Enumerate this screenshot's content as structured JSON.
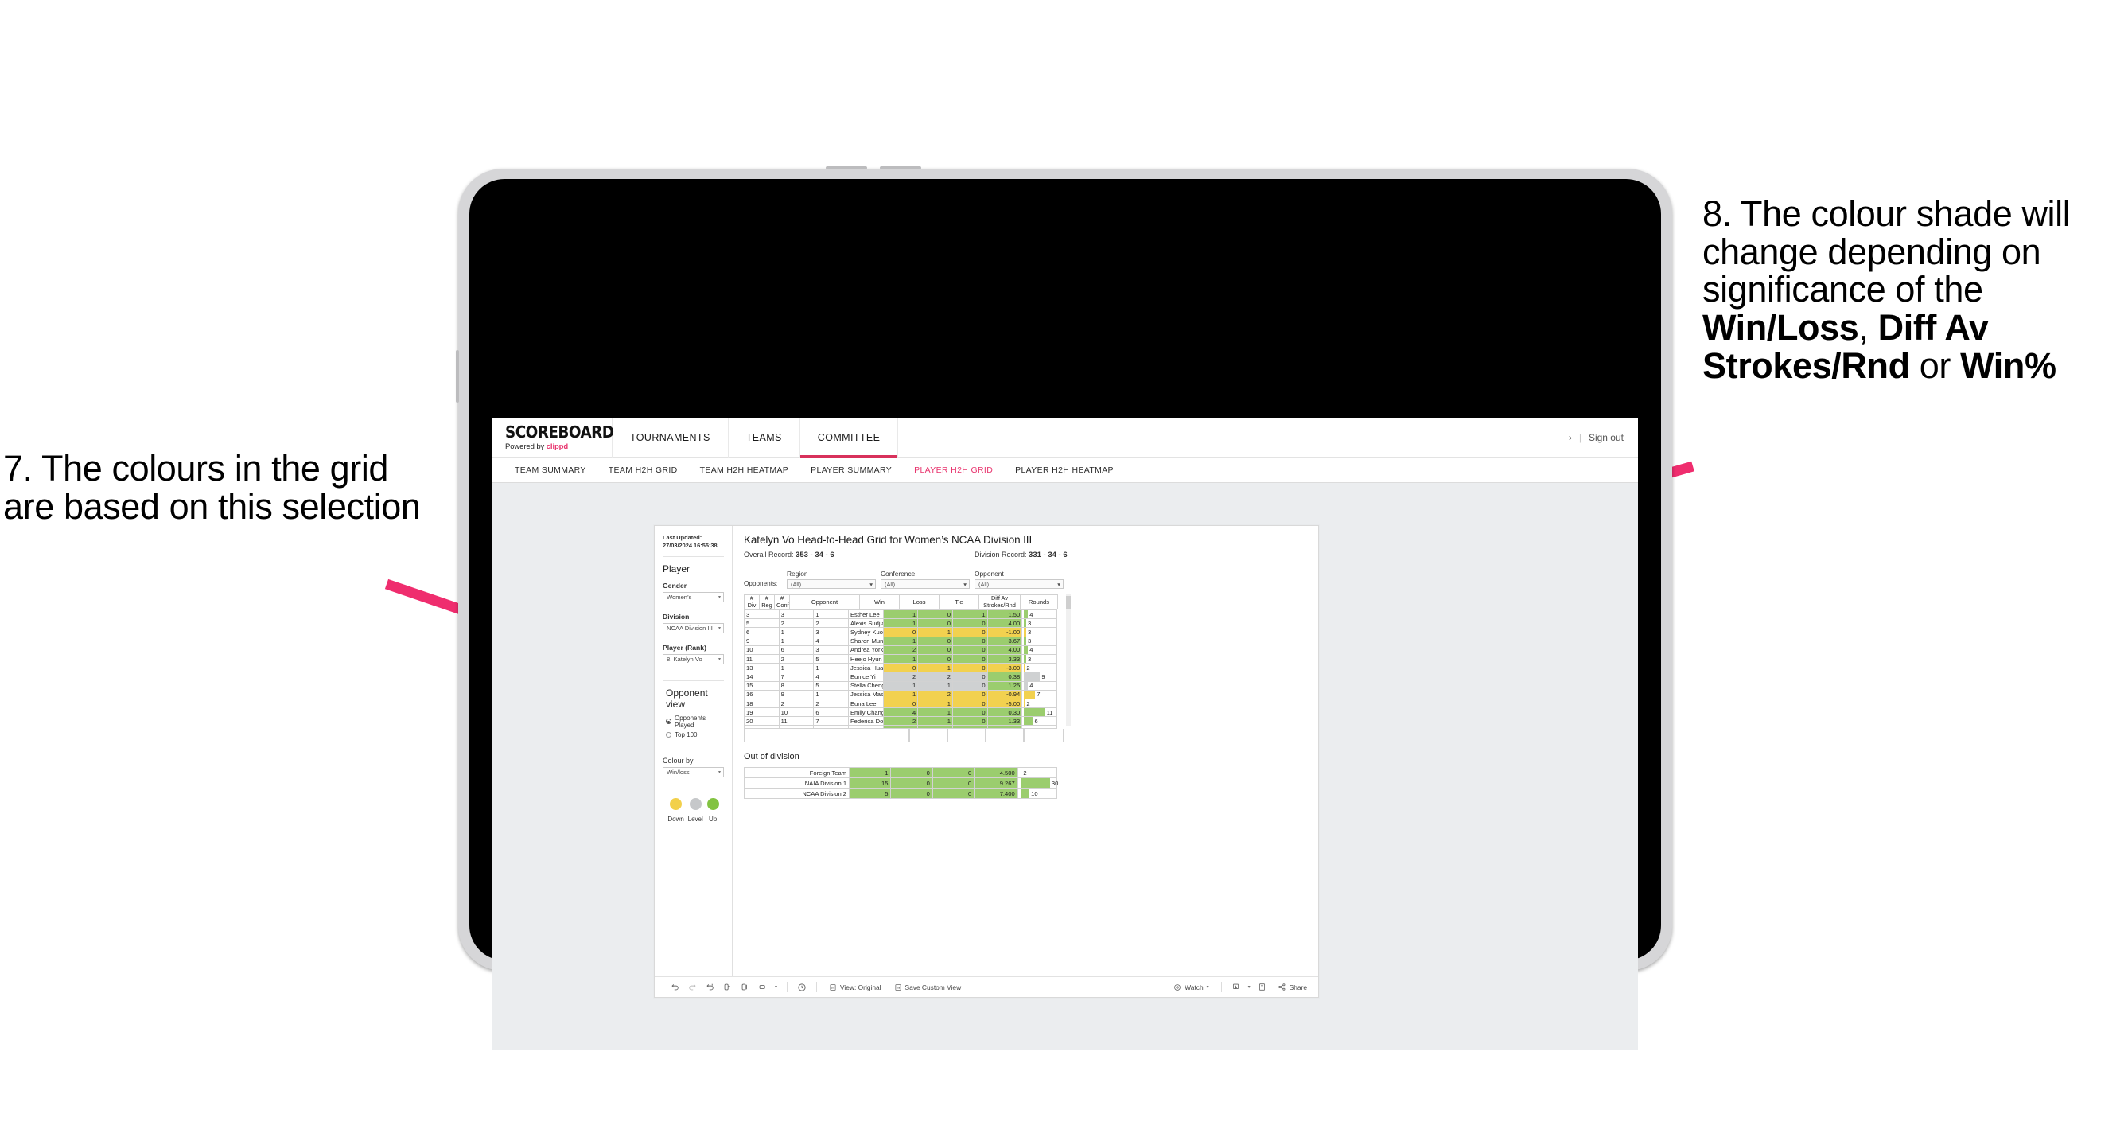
{
  "annotations": {
    "left": {
      "id": "annotation-7",
      "text": "7. The colours in the grid are based on this selection"
    },
    "right": {
      "id": "annotation-8",
      "line1": "8. The colour shade will change depending on significance of the ",
      "bold1": "Win/Loss",
      "mid1": ", ",
      "bold2": "Diff Av Strokes/Rnd",
      "mid2": " or ",
      "bold3": "Win%"
    },
    "arrow_color": "#ef2d6e"
  },
  "header": {
    "logo_main": "SCOREBOARD",
    "logo_sub_prefix": "Powered by ",
    "logo_sub_brand": "clippd",
    "nav": [
      {
        "label": "TOURNAMENTS",
        "active": false
      },
      {
        "label": "TEAMS",
        "active": false
      },
      {
        "label": "COMMITTEE",
        "active": true
      }
    ],
    "chevron": "›",
    "separator": "|",
    "sign_out": "Sign out"
  },
  "subnav": [
    {
      "label": "TEAM SUMMARY",
      "active": false
    },
    {
      "label": "TEAM H2H GRID",
      "active": false
    },
    {
      "label": "TEAM H2H HEATMAP",
      "active": false
    },
    {
      "label": "PLAYER SUMMARY",
      "active": false
    },
    {
      "label": "PLAYER H2H GRID",
      "active": true
    },
    {
      "label": "PLAYER H2H HEATMAP",
      "active": false
    }
  ],
  "sidebar": {
    "last_updated": "Last Updated: 27/03/2024 16:55:38",
    "player_heading": "Player",
    "fields": [
      {
        "label": "Gender",
        "value": "Women’s"
      },
      {
        "label": "Division",
        "value": "NCAA Division III"
      },
      {
        "label": "Player (Rank)",
        "value": "8. Katelyn Vo"
      }
    ],
    "opponent_view_heading": "Opponent view",
    "opponent_view_options": [
      {
        "label": "Opponents Played",
        "checked": true
      },
      {
        "label": "Top 100",
        "checked": false
      }
    ],
    "colour_by_label": "Colour by",
    "colour_by_value": "Win/loss",
    "legend": [
      {
        "label": "Down",
        "color": "#f2d04b"
      },
      {
        "label": "Level",
        "color": "#c6c8ca"
      },
      {
        "label": "Up",
        "color": "#82c341"
      }
    ]
  },
  "main": {
    "title": "Katelyn Vo Head-to-Head Grid for Women’s NCAA Division III",
    "overall_label": "Overall Record: ",
    "overall_value": "353 -  34 - 6",
    "division_label": "Division Record: ",
    "division_value": "331 -  34 - 6",
    "opponents_label": "Opponents:",
    "filters": [
      {
        "label": "Region",
        "value": "(All)"
      },
      {
        "label": "Conference",
        "value": "(All)"
      },
      {
        "label": "Opponent",
        "value": "(All)"
      }
    ],
    "columns": {
      "div": "#\nDiv",
      "div_l1": "#",
      "div_l2": "Div",
      "reg_l1": "#",
      "reg_l2": "Reg",
      "conf_l1": "#",
      "conf_l2": "Conf",
      "opponent": "Opponent",
      "win": "Win",
      "loss": "Loss",
      "tie": "Tie",
      "diff_l1": "Diff Av",
      "diff_l2": "Strokes/Rnd",
      "rounds": "Rounds"
    },
    "out_of_division_title": "Out of division"
  },
  "chart_data": {
    "type": "table",
    "title": "Katelyn Vo Head-to-Head Grid for Women’s NCAA Division III",
    "colour_by": "Win/loss",
    "legend": {
      "down": "#f2d04b",
      "level": "#c6c8ca",
      "up": "#82c341"
    },
    "columns": [
      "# Div",
      "# Reg",
      "# Conf",
      "Opponent",
      "Win",
      "Loss",
      "Tie",
      "Diff Av Strokes/Rnd",
      "Rounds"
    ],
    "rows": [
      {
        "div": "3",
        "reg": "3",
        "conf": "1",
        "opponent": "Esther Lee",
        "win": "1",
        "loss": "0",
        "tie": "1",
        "diff": "1.50",
        "rounds": 4,
        "fill": "#9bcd6e",
        "diff_fill": "#9bcd6e",
        "bar_pct": 13
      },
      {
        "div": "5",
        "reg": "2",
        "conf": "2",
        "opponent": "Alexis Sudjianto",
        "win": "1",
        "loss": "0",
        "tie": "0",
        "diff": "4.00",
        "rounds": 3,
        "fill": "#9bcd6e",
        "diff_fill": "#9bcd6e",
        "bar_pct": 7
      },
      {
        "div": "6",
        "reg": "1",
        "conf": "3",
        "opponent": "Sydney Kuo",
        "win": "0",
        "loss": "1",
        "tie": "0",
        "diff": "-1.00",
        "rounds": 3,
        "fill": "#f2d14f",
        "diff_fill": "#f2d14f",
        "bar_pct": 7
      },
      {
        "div": "9",
        "reg": "1",
        "conf": "4",
        "opponent": "Sharon Mun",
        "win": "1",
        "loss": "0",
        "tie": "0",
        "diff": "3.67",
        "rounds": 3,
        "fill": "#9bcd6e",
        "diff_fill": "#9bcd6e",
        "bar_pct": 7
      },
      {
        "div": "10",
        "reg": "6",
        "conf": "3",
        "opponent": "Andrea York",
        "win": "2",
        "loss": "0",
        "tie": "0",
        "diff": "4.00",
        "rounds": 4,
        "fill": "#9bcd6e",
        "diff_fill": "#9bcd6e",
        "bar_pct": 13
      },
      {
        "div": "11",
        "reg": "2",
        "conf": "5",
        "opponent": "Heejo Hyun",
        "win": "1",
        "loss": "0",
        "tie": "0",
        "diff": "3.33",
        "rounds": 3,
        "fill": "#9bcd6e",
        "diff_fill": "#9bcd6e",
        "bar_pct": 7
      },
      {
        "div": "13",
        "reg": "1",
        "conf": "1",
        "opponent": "Jessica Huang",
        "win": "0",
        "loss": "1",
        "tie": "0",
        "diff": "-3.00",
        "rounds": 2,
        "fill": "#f2d14f",
        "diff_fill": "#f2d14f",
        "bar_pct": 3
      },
      {
        "div": "14",
        "reg": "7",
        "conf": "4",
        "opponent": "Eunice Yi",
        "win": "2",
        "loss": "2",
        "tie": "0",
        "diff": "0.38",
        "rounds": 9,
        "fill": "#cfd1d2",
        "diff_fill": "#9bcd6e",
        "bar_pct": 52
      },
      {
        "div": "15",
        "reg": "8",
        "conf": "5",
        "opponent": "Stella Cheng",
        "win": "1",
        "loss": "1",
        "tie": "0",
        "diff": "1.25",
        "rounds": 4,
        "fill": "#cfd1d2",
        "diff_fill": "#9bcd6e",
        "bar_pct": 13
      },
      {
        "div": "16",
        "reg": "9",
        "conf": "1",
        "opponent": "Jessica Mason",
        "win": "1",
        "loss": "2",
        "tie": "0",
        "diff": "-0.94",
        "rounds": 7,
        "fill": "#f2d14f",
        "diff_fill": "#f2d14f",
        "bar_pct": 36
      },
      {
        "div": "18",
        "reg": "2",
        "conf": "2",
        "opponent": "Euna Lee",
        "win": "0",
        "loss": "1",
        "tie": "0",
        "diff": "-5.00",
        "rounds": 2,
        "fill": "#f2d14f",
        "diff_fill": "#f2d14f",
        "bar_pct": 3
      },
      {
        "div": "19",
        "reg": "10",
        "conf": "6",
        "opponent": "Emily Chang",
        "win": "4",
        "loss": "1",
        "tie": "0",
        "diff": "0.30",
        "rounds": 11,
        "fill": "#9bcd6e",
        "diff_fill": "#9bcd6e",
        "bar_pct": 68
      },
      {
        "div": "20",
        "reg": "11",
        "conf": "7",
        "opponent": "Federica Domecq Lacroze",
        "win": "2",
        "loss": "1",
        "tie": "0",
        "diff": "1.33",
        "rounds": 6,
        "fill": "#9bcd6e",
        "diff_fill": "#9bcd6e",
        "bar_pct": 29
      }
    ],
    "out_of_division": [
      {
        "name": "Foreign Team",
        "win": "1",
        "loss": "0",
        "tie": "0",
        "diff": "4.500",
        "rounds": 2,
        "fill": "#9bcd6e",
        "bar_pct": 4
      },
      {
        "name": "NAIA Division 1",
        "win": "15",
        "loss": "0",
        "tie": "0",
        "diff": "9.267",
        "rounds": 30,
        "fill": "#9bcd6e",
        "bar_pct": 88
      },
      {
        "name": "NCAA Division 2",
        "win": "5",
        "loss": "0",
        "tie": "0",
        "diff": "7.400",
        "rounds": 10,
        "fill": "#9bcd6e",
        "bar_pct": 27
      }
    ]
  },
  "toolbar": {
    "icons": [
      "undo-icon",
      "redo-icon",
      "revert-icon",
      "refresh-data-icon",
      "pause-icon",
      "rectangle-select-icon",
      "caret-icon",
      "clock-icon"
    ],
    "view_label": "View: Original",
    "save_label": "Save Custom View",
    "watch_label": "Watch",
    "share_label": "Share",
    "caret": "▾"
  }
}
